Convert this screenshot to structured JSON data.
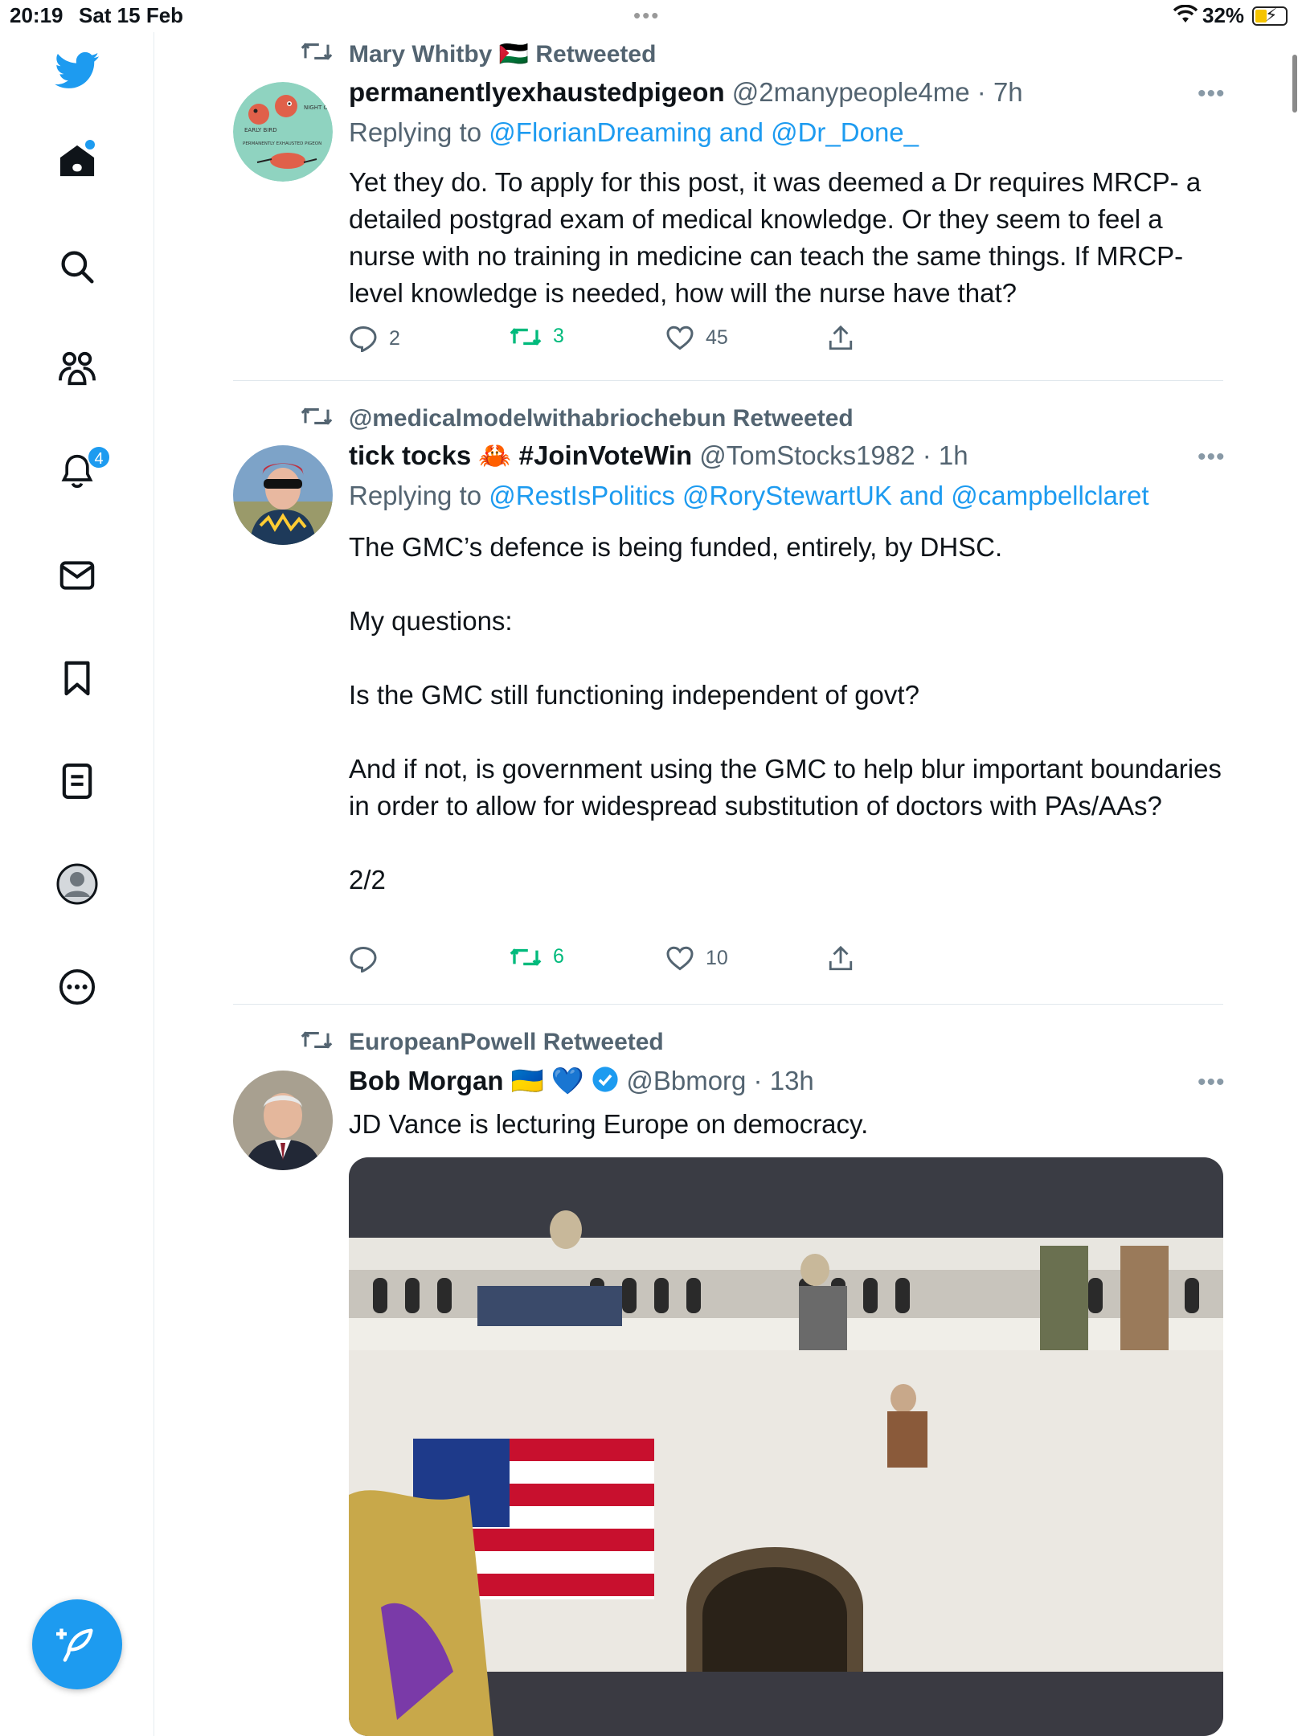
{
  "status": {
    "time": "20:19",
    "date": "Sat 15 Feb",
    "dots": "•••",
    "battery": "32%"
  },
  "sidebar": {
    "notifications_badge": "4"
  },
  "tweets": [
    {
      "retweeted_by": "Mary Whitby 🇵🇸 Retweeted",
      "name": "permanentlyexhaustedpigeon",
      "handle": "@2manypeople4me · 7h",
      "replying_prefix": "Replying to",
      "replying_links": "@FlorianDreaming and @Dr_Done_",
      "body": "Yet they do. To apply for this post, it was deemed a Dr requires MRCP- a detailed postgrad exam of medical knowledge. Or they seem to feel a nurse with no training in medicine can teach the same things. If MRCP-level knowledge is needed, how will the nurse have that?",
      "replies": "2",
      "retweets": "3",
      "likes": "45",
      "avatar_text": {
        "early": "EARLY BIRD",
        "night": "NIGHT OWL",
        "pigeon": "PERMANENTLY EXHAUSTED PIGEON"
      }
    },
    {
      "retweeted_by": "@medicalmodelwithabriochebun Retweeted",
      "name": "tick tocks 🦀 #JoinVoteWin",
      "handle": "@TomStocks1982 · 1h",
      "replying_prefix": "Replying to",
      "replying_links": "@RestIsPolitics @RoryStewartUK and @campbellclaret",
      "body_lines": [
        "The GMC’s defence is being funded, entirely, by DHSC.",
        "",
        "My questions:",
        "",
        "Is the GMC still functioning independent of govt?",
        "",
        "And if not, is government using the GMC to help blur important boundaries in order to allow for widespread substitution of doctors with PAs/AAs?",
        "",
        "2/2"
      ],
      "replies": "",
      "retweets": "6",
      "likes": "10"
    },
    {
      "retweeted_by": "EuropeanPowell Retweeted",
      "name": "Bob Morgan 🇺🇦 💙",
      "handle": "@Bbmorg · 13h",
      "body": "JD Vance is lecturing Europe on democracy."
    }
  ],
  "icons": {
    "sidebar": [
      "twitter-bird-icon",
      "home-icon",
      "search-icon",
      "communities-icon",
      "notifications-icon",
      "messages-icon",
      "bookmarks-icon",
      "lists-icon",
      "profile-icon",
      "more-icon"
    ],
    "actions": [
      "reply-icon",
      "retweet-icon",
      "like-icon",
      "share-icon"
    ]
  },
  "colors": {
    "accent": "#1d9bf0",
    "retweet_green": "#00ba7c",
    "muted": "#536471"
  }
}
